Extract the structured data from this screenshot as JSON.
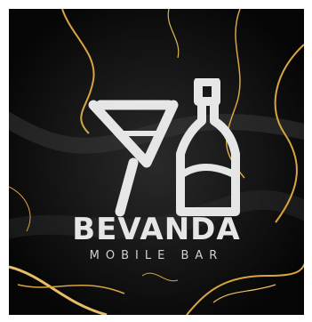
{
  "brand": {
    "name": "BEVANDA",
    "tagline": "MOBILE BAR"
  },
  "colors": {
    "background": "#0b0b0b",
    "marble_gold": "#d9a441",
    "logo": "#e6e6e6"
  },
  "icons": {
    "logo": "cocktail-glass-and-bottle-icon"
  }
}
